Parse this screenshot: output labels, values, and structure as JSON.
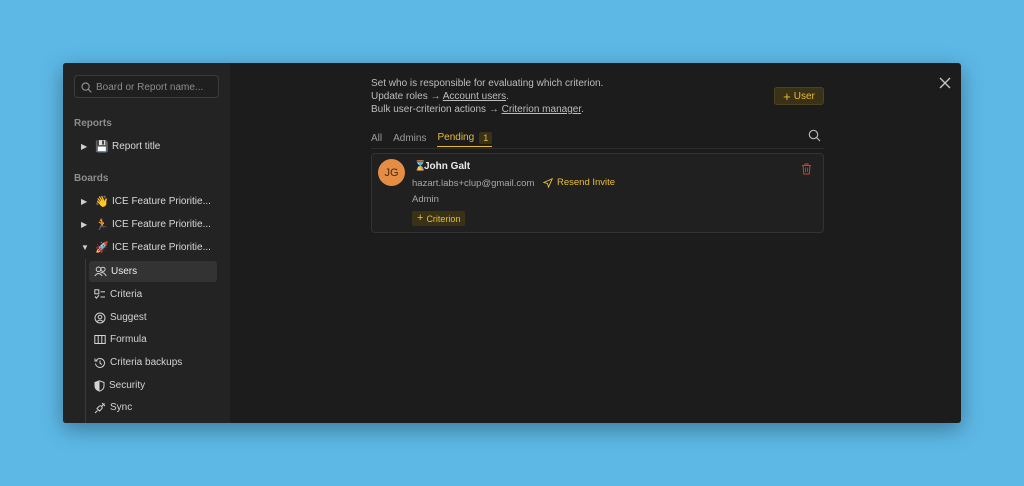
{
  "colors": {
    "background": "#5db8e6",
    "window": "#1c1c1c",
    "sidebar": "#232323",
    "accent": "#e8bd37",
    "avatar": "#e58c45",
    "danger": "#c8432f"
  },
  "sidebar": {
    "search_placeholder": "Board or Report name...",
    "reports_title": "Reports",
    "reports": [
      {
        "emoji": "💾",
        "label": "Report title"
      }
    ],
    "boards_title": "Boards",
    "boards": [
      {
        "emoji": "👋",
        "label": "ICE Feature Prioritie..."
      },
      {
        "emoji": "🏃",
        "label": "ICE Feature Prioritie..."
      },
      {
        "emoji": "🚀",
        "label": "ICE Feature Prioritie..."
      }
    ],
    "nav": [
      {
        "icon": "users-icon",
        "label": "Users"
      },
      {
        "icon": "criteria-icon",
        "label": "Criteria"
      },
      {
        "icon": "suggest-icon",
        "label": "Suggest"
      },
      {
        "icon": "formula-icon",
        "label": "Formula"
      },
      {
        "icon": "history-icon",
        "label": "Criteria backups"
      },
      {
        "icon": "shield-icon",
        "label": "Security"
      },
      {
        "icon": "plug-icon",
        "label": "Sync"
      }
    ]
  },
  "main": {
    "info_line1": "Set who is responsible for evaluating which criterion.",
    "info_line2_prefix": "Update roles → ",
    "info_line2_link": "Account users",
    "info_line3_prefix": "Bulk user-criterion actions → ",
    "info_line3_link": "Criterion manager",
    "period": ".",
    "add_user_label": "User",
    "tabs": [
      {
        "label": "All"
      },
      {
        "label": "Admins"
      },
      {
        "label": "Pending",
        "count": "1"
      }
    ],
    "users": [
      {
        "initials": "JG",
        "name": "John Galt",
        "email": "hazart.labs+clup@gmail.com",
        "resend_label": "Resend Invite",
        "role": "Admin",
        "criterion_label": "Criterion"
      }
    ]
  }
}
